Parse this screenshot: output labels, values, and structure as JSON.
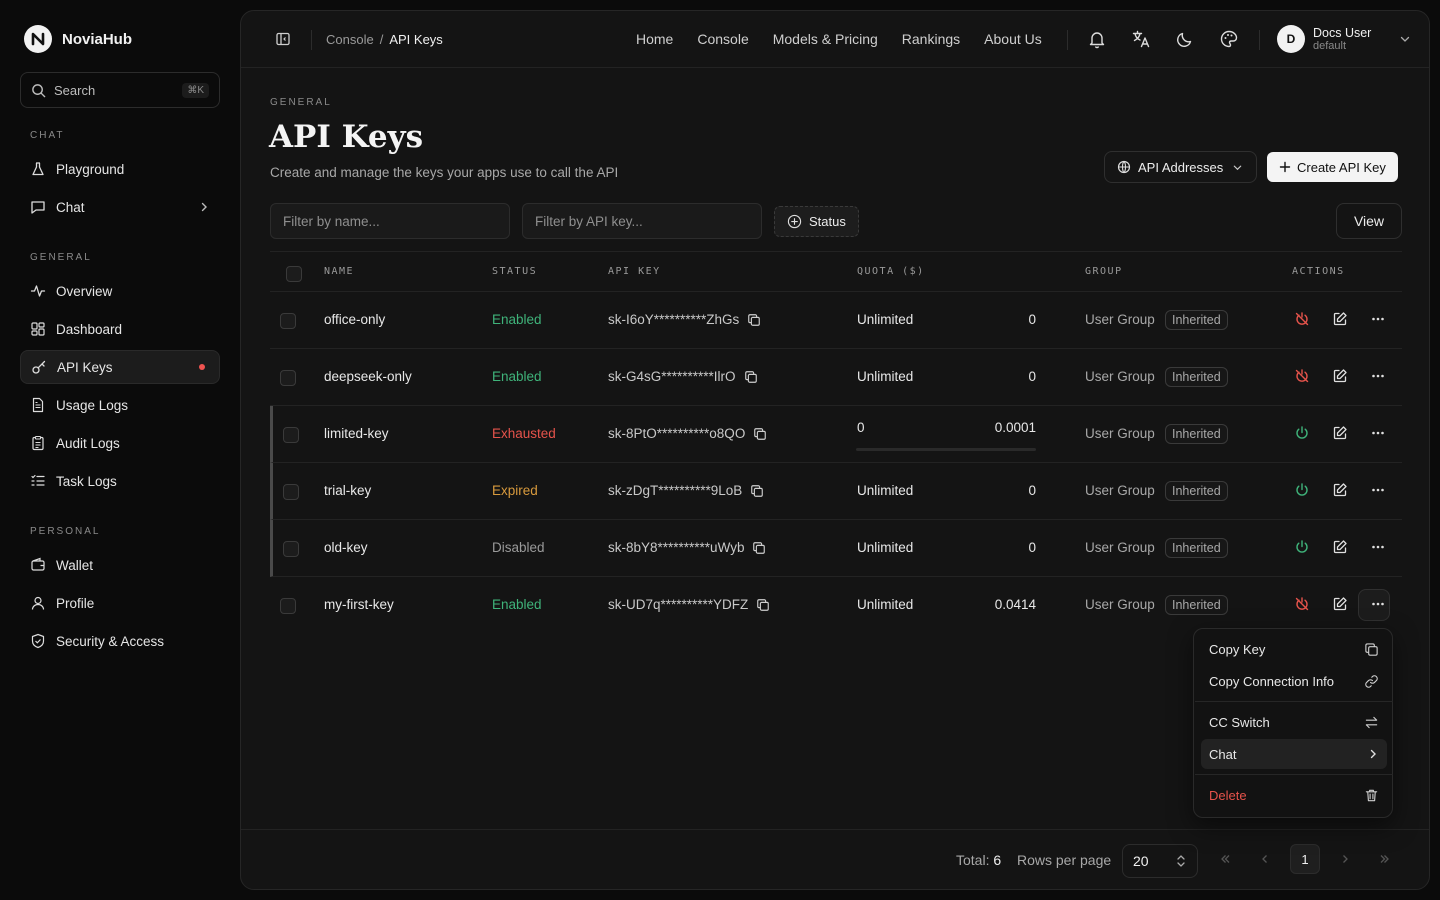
{
  "app": {
    "name": "NoviaHub",
    "logo_letter": "N"
  },
  "search": {
    "label": "Search",
    "shortcut": "⌘K"
  },
  "sidebar": {
    "sections": [
      {
        "label": "CHAT"
      },
      {
        "label": "GENERAL"
      },
      {
        "label": "PERSONAL"
      }
    ],
    "items": [
      {
        "label": "Playground",
        "icon": "flask-icon"
      },
      {
        "label": "Chat",
        "icon": "message-icon"
      },
      {
        "label": "Overview",
        "icon": "activity-icon"
      },
      {
        "label": "Dashboard",
        "icon": "grid-icon"
      },
      {
        "label": "API Keys",
        "icon": "key-icon",
        "active": true
      },
      {
        "label": "Usage Logs",
        "icon": "file-icon"
      },
      {
        "label": "Audit Logs",
        "icon": "clipboard-icon"
      },
      {
        "label": "Task Logs",
        "icon": "list-icon"
      },
      {
        "label": "Wallet",
        "icon": "wallet-icon"
      },
      {
        "label": "Profile",
        "icon": "user-icon"
      },
      {
        "label": "Security & Access",
        "icon": "shield-icon"
      }
    ]
  },
  "header": {
    "breadcrumb": {
      "parent": "Console",
      "separator": "/",
      "current": "API Keys"
    },
    "nav": [
      "Home",
      "Console",
      "Models & Pricing",
      "Rankings",
      "About Us"
    ],
    "user": {
      "initial": "D",
      "name": "Docs User",
      "group": "default"
    }
  },
  "page": {
    "eyebrow": "GENERAL",
    "title": "API Keys",
    "subtitle": "Create and manage the keys your apps use to call the API",
    "api_addresses_label": "API Addresses",
    "create_label": "Create API Key"
  },
  "filters": {
    "name_placeholder": "Filter by name...",
    "key_placeholder": "Filter by API key...",
    "status_label": "Status",
    "view_label": "View"
  },
  "table": {
    "columns": [
      "NAME",
      "STATUS",
      "API KEY",
      "QUOTA ($)",
      "GROUP",
      "ACTIONS"
    ],
    "rows": [
      {
        "name": "office-only",
        "status": "Enabled",
        "key": "sk-I6oY**********ZhGs",
        "quota": "Unlimited",
        "used": "0",
        "group": "User Group",
        "badge": "Inherited",
        "toggle": "disable"
      },
      {
        "name": "deepseek-only",
        "status": "Enabled",
        "key": "sk-G4sG**********IlrO",
        "quota": "Unlimited",
        "used": "0",
        "group": "User Group",
        "badge": "Inherited",
        "toggle": "disable"
      },
      {
        "name": "limited-key",
        "status": "Exhausted",
        "key": "sk-8PtO**********o8QO",
        "quota": "0",
        "used": "0.0001",
        "quota_used_fraction": 0,
        "group": "User Group",
        "badge": "Inherited",
        "toggle": "enable"
      },
      {
        "name": "trial-key",
        "status": "Expired",
        "key": "sk-zDgT**********9LoB",
        "quota": "Unlimited",
        "used": "0",
        "group": "User Group",
        "badge": "Inherited",
        "toggle": "enable"
      },
      {
        "name": "old-key",
        "status": "Disabled",
        "key": "sk-8bY8**********uWyb",
        "quota": "Unlimited",
        "used": "0",
        "group": "User Group",
        "badge": "Inherited",
        "toggle": "enable"
      },
      {
        "name": "my-first-key",
        "status": "Enabled",
        "key": "sk-UD7q**********YDFZ",
        "quota": "Unlimited",
        "used": "0.0414",
        "group": "User Group",
        "badge": "Inherited",
        "toggle": "disable"
      }
    ]
  },
  "menu": {
    "items": [
      {
        "label": "Copy Key",
        "icon": "copy-icon"
      },
      {
        "label": "Copy Connection Info",
        "icon": "link-icon"
      },
      {
        "label": "CC Switch",
        "icon": "swap-icon"
      },
      {
        "label": "Chat",
        "icon": "chevron-right-icon"
      },
      {
        "label": "Delete",
        "icon": "trash-icon"
      }
    ]
  },
  "footer": {
    "total_label": "Total:",
    "total": "6",
    "rows_label": "Rows per page",
    "rows_value": "20",
    "current_page": "1"
  },
  "colors": {
    "enabled": "#3fb37a",
    "exhausted": "#e5534b",
    "expired": "#d89a3d",
    "disabled": "#9a9a9a",
    "danger": "#e5534b"
  }
}
